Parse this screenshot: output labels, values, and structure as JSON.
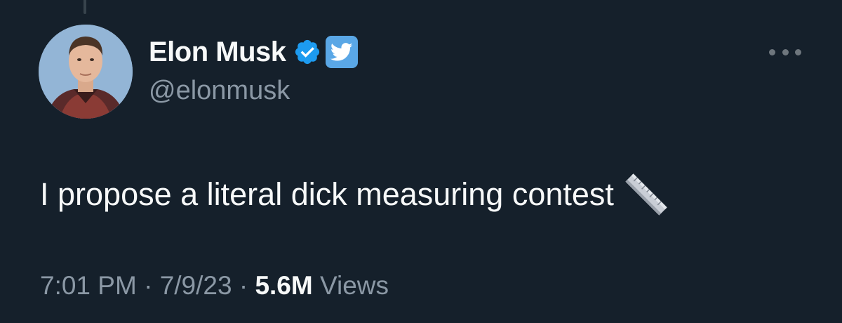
{
  "author": {
    "display_name": "Elon Musk",
    "handle": "@elonmusk",
    "verified_icon": "verified-badge-icon",
    "twitter_badge_icon": "twitter-bird-icon"
  },
  "tweet": {
    "text": "I propose a literal dick measuring contest",
    "emoji_icon": "straight-ruler-icon"
  },
  "meta": {
    "time": "7:01 PM",
    "separator1": " · ",
    "date": "7/9/23",
    "separator2": " · ",
    "views_count": "5.6M",
    "views_label": " Views"
  },
  "colors": {
    "background": "#15202b",
    "primary_text": "#f7f9f9",
    "secondary_text": "#8b98a5",
    "verified_blue": "#1d9bf0",
    "twitter_badge": "#5aa7e6"
  }
}
